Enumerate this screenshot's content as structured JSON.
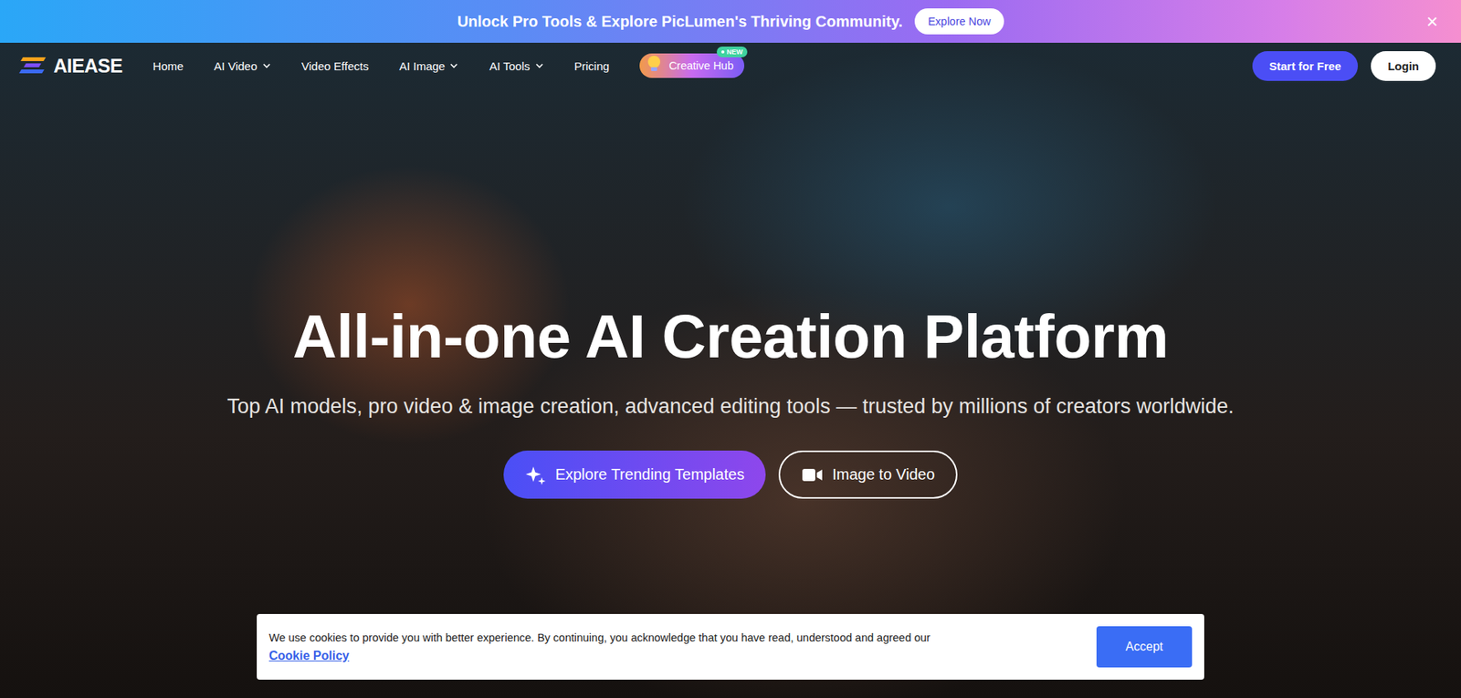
{
  "promo_banner": {
    "text": "Unlock Pro Tools & Explore PicLumen's Thriving Community.",
    "button": "Explore Now",
    "close": "×"
  },
  "nav": {
    "logo": "AIEASE",
    "items": [
      {
        "label": "Home",
        "has_menu": false
      },
      {
        "label": "AI Video",
        "has_menu": true
      },
      {
        "label": "Video Effects",
        "has_menu": false
      },
      {
        "label": "AI Image",
        "has_menu": true
      },
      {
        "label": "AI Tools",
        "has_menu": true
      },
      {
        "label": "Pricing",
        "has_menu": false
      }
    ],
    "creative_hub": {
      "label": "Creative Hub",
      "badge": "NEW"
    },
    "buttons": [
      {
        "label": "Start for Free",
        "kind": "primary"
      },
      {
        "label": "Login",
        "kind": "light"
      }
    ]
  },
  "hero": {
    "title": "All-in-one AI Creation Platform",
    "subtitle": "Top AI models, pro video & image creation, advanced editing tools — trusted by millions of creators worldwide.",
    "buttons": [
      {
        "label": "Explore Trending Templates",
        "kind": "primary"
      },
      {
        "label": "Image to Video",
        "kind": "outline"
      }
    ]
  },
  "cookie_banner": {
    "text": "We use cookies to provide you with better experience. By continuing, you acknowledge that you have read, understood and agreed our",
    "link": "Cookie Policy",
    "button": "Accept"
  }
}
